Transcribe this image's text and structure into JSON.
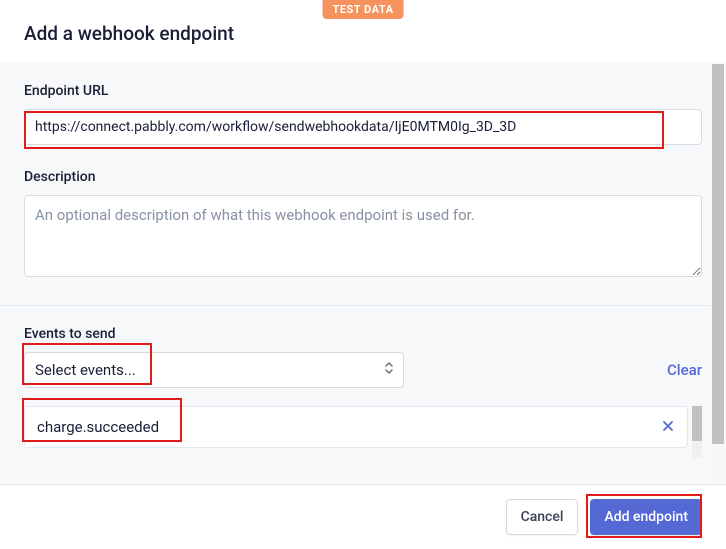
{
  "badge": {
    "label": "TEST DATA"
  },
  "header": {
    "title": "Add a webhook endpoint"
  },
  "form": {
    "endpoint_url": {
      "label": "Endpoint URL",
      "value": "https://connect.pabbly.com/workflow/sendwebhookdata/IjE0MTM0Ig_3D_3D"
    },
    "description": {
      "label": "Description",
      "placeholder": "An optional description of what this webhook endpoint is used for.",
      "value": ""
    },
    "events": {
      "label": "Events to send",
      "select_placeholder": "Select events...",
      "clear_label": "Clear",
      "items": [
        {
          "name": "charge.succeeded"
        }
      ]
    }
  },
  "footer": {
    "cancel_label": "Cancel",
    "submit_label": "Add endpoint"
  }
}
